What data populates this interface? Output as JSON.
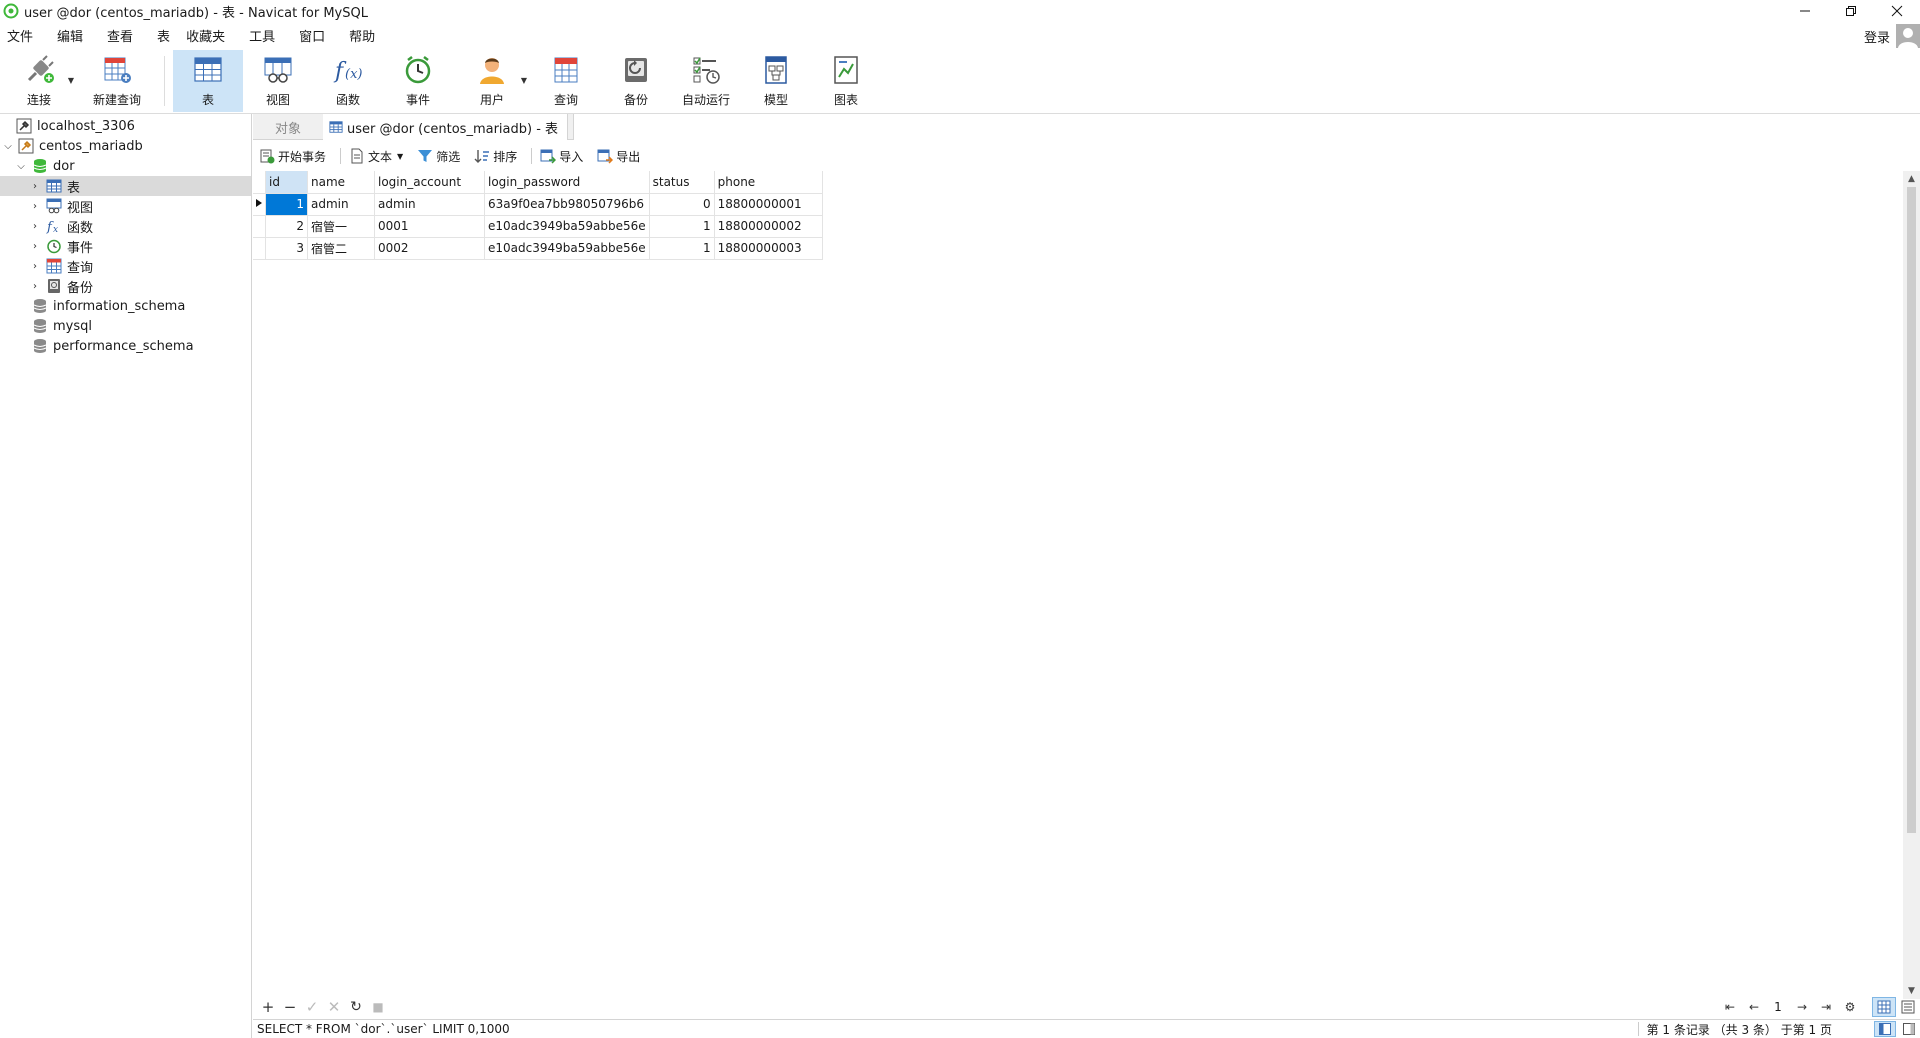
{
  "window": {
    "title": "user @dor (centos_mariadb) - 表 - Navicat for MySQL"
  },
  "menu": [
    "文件",
    "编辑",
    "查看",
    "表",
    "收藏夹",
    "工具",
    "窗口",
    "帮助"
  ],
  "login_label": "登录",
  "toolbar": [
    {
      "label": "连接",
      "icon": "connection-icon"
    },
    {
      "label": "新建查询",
      "icon": "new-query-icon"
    },
    {
      "label": "表",
      "icon": "table-icon"
    },
    {
      "label": "视图",
      "icon": "view-icon"
    },
    {
      "label": "函数",
      "icon": "function-icon"
    },
    {
      "label": "事件",
      "icon": "event-icon"
    },
    {
      "label": "用户",
      "icon": "user-icon"
    },
    {
      "label": "查询",
      "icon": "query-icon"
    },
    {
      "label": "备份",
      "icon": "backup-icon"
    },
    {
      "label": "自动运行",
      "icon": "automation-icon"
    },
    {
      "label": "模型",
      "icon": "model-icon"
    },
    {
      "label": "图表",
      "icon": "chart-icon"
    }
  ],
  "tree": {
    "items": [
      {
        "label": "localhost_3306"
      },
      {
        "label": "centos_mariadb"
      },
      {
        "label": "dor"
      },
      {
        "label": "表"
      },
      {
        "label": "视图"
      },
      {
        "label": "函数"
      },
      {
        "label": "事件"
      },
      {
        "label": "查询"
      },
      {
        "label": "备份"
      },
      {
        "label": "information_schema"
      },
      {
        "label": "mysql"
      },
      {
        "label": "performance_schema"
      }
    ]
  },
  "tabs": {
    "objects": "对象",
    "active": "user @dor (centos_mariadb) - 表"
  },
  "subtoolbar": {
    "begin_transaction": "开始事务",
    "text": "文本",
    "filter": "筛选",
    "sort": "排序",
    "import": "导入",
    "export": "导出"
  },
  "table": {
    "columns": [
      "id",
      "name",
      "login_account",
      "login_password",
      "status",
      "phone"
    ],
    "rows": [
      [
        "1",
        "admin",
        "admin",
        "63a9f0ea7bb98050796b6",
        "0",
        "18800000001"
      ],
      [
        "2",
        "宿管一",
        "0001",
        "e10adc3949ba59abbe56e",
        "1",
        "18800000002"
      ],
      [
        "3",
        "宿管二",
        "0002",
        "e10adc3949ba59abbe56e",
        "1",
        "18800000003"
      ]
    ]
  },
  "pagination": {
    "page": "1"
  },
  "status": {
    "sql": "SELECT * FROM `dor`.`user` LIMIT 0,1000",
    "records": "第 1 条记录 （共 3 条） 于第 1 页"
  },
  "colors": {
    "accent": "#0078d7",
    "selected_toolbar": "#cde4f7",
    "db_green": "#3fb83a"
  }
}
